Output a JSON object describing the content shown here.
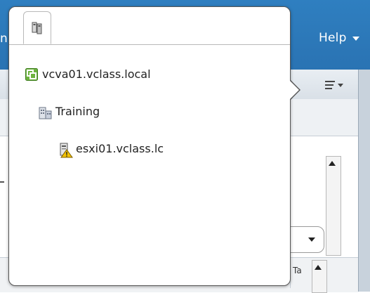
{
  "header": {
    "left_fragment": "n",
    "help_label": "Help"
  },
  "content": {
    "column_header": "Ta"
  },
  "popover": {
    "tab_icon": "hosts-and-clusters-icon",
    "tree": [
      {
        "label": "vcva01.vclass.local",
        "icon": "vcenter-icon"
      },
      {
        "label": "Training",
        "icon": "datacenter-icon"
      },
      {
        "label": "esxi01.vclass.lc",
        "icon": "host-warning-icon"
      }
    ]
  },
  "colors": {
    "header_blue": "#2f7fc0",
    "vcenter_green": "#6db33f",
    "warning_yellow": "#f2c200"
  }
}
